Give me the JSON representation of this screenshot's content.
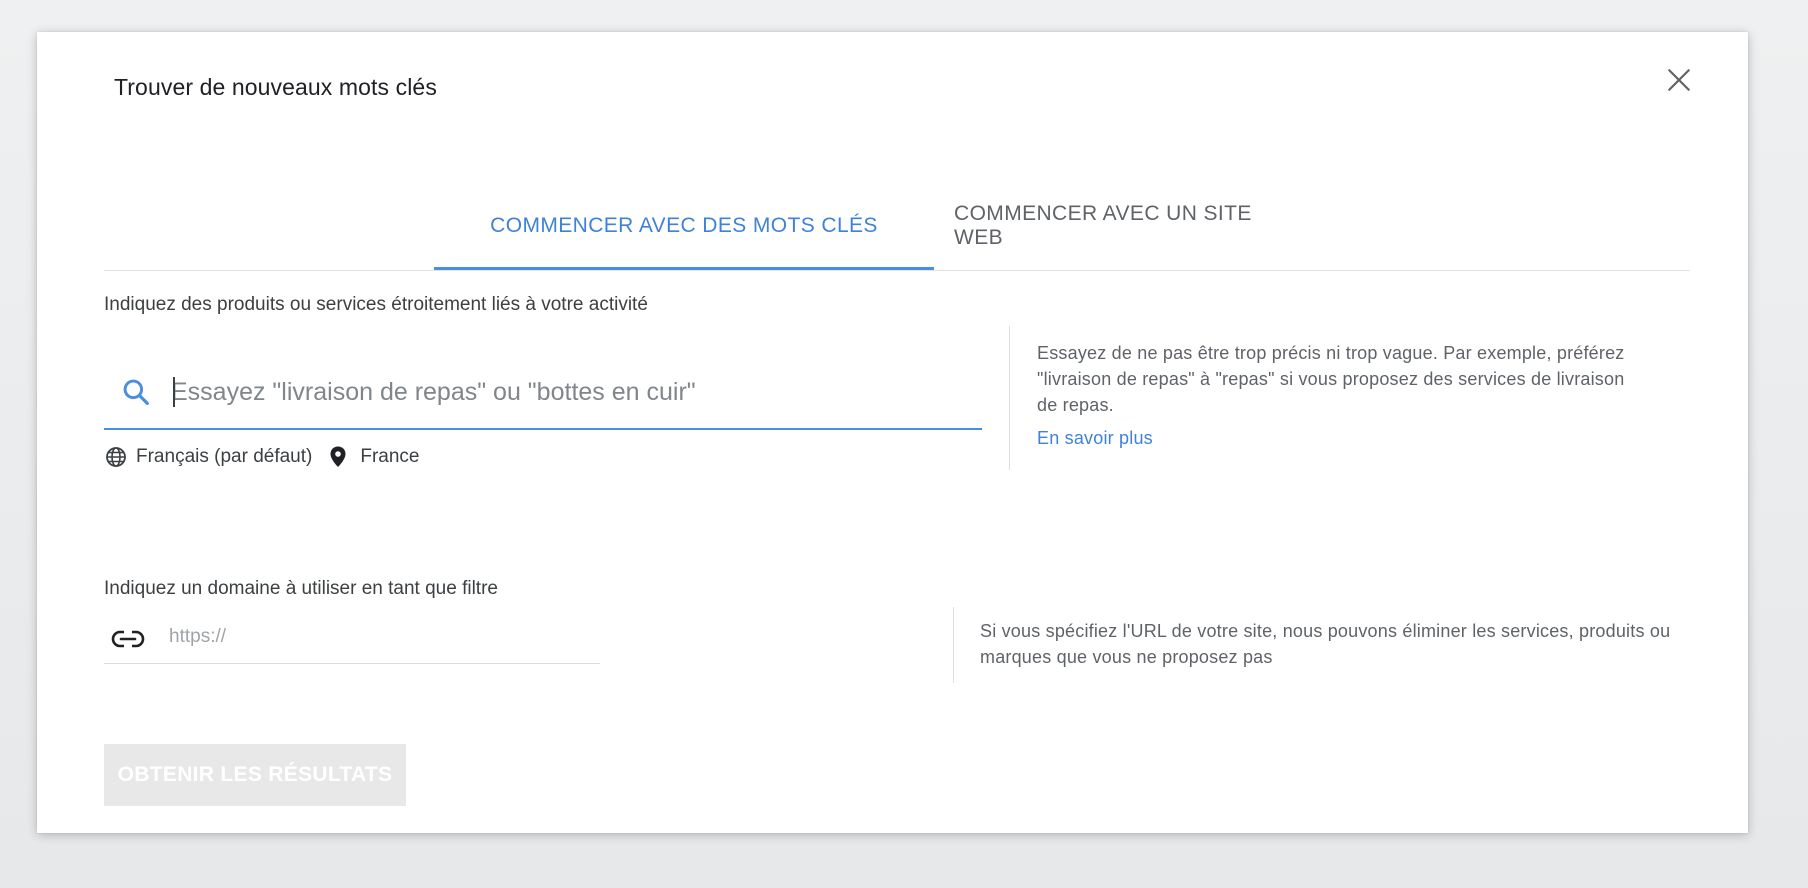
{
  "dialog": {
    "title": "Trouver de nouveaux mots clés"
  },
  "tabs": [
    {
      "label": "COMMENCER AVEC DES MOTS CLÉS",
      "active": true
    },
    {
      "label": "COMMENCER AVEC UN SITE WEB",
      "active": false
    }
  ],
  "keyword_section": {
    "label": "Indiquez des produits ou services étroitement liés à votre activité",
    "input_value": "",
    "input_placeholder": "Essayez \"livraison de repas\" ou \"bottes en cuir\"",
    "language": "Français (par défaut)",
    "location": "France",
    "tip": "Essayez de ne pas être trop précis ni trop vague. Par exemple, préférez \"livraison de repas\" à \"repas\" si vous proposez des services de livraison de repas.",
    "learn_more": "En savoir plus"
  },
  "domain_section": {
    "label": "Indiquez un domaine à utiliser en tant que filtre",
    "input_value": "",
    "input_placeholder": "https://",
    "tip": "Si vous spécifiez l'URL de votre site, nous pouvons éliminer les services, produits ou marques que vous ne proposez pas"
  },
  "footer": {
    "results_button": "OBTENIR LES RÉSULTATS",
    "results_button_disabled": true
  },
  "icons": {
    "close": "close-icon",
    "search": "search-icon",
    "language": "globe-icon",
    "location": "location-pin-icon",
    "domain": "link-icon"
  },
  "colors": {
    "accent": "#4a8ee0",
    "tab_active_text": "#3f82d8",
    "tab_inactive_text": "#5f6368",
    "button_disabled_bg": "#e8e8e8"
  }
}
